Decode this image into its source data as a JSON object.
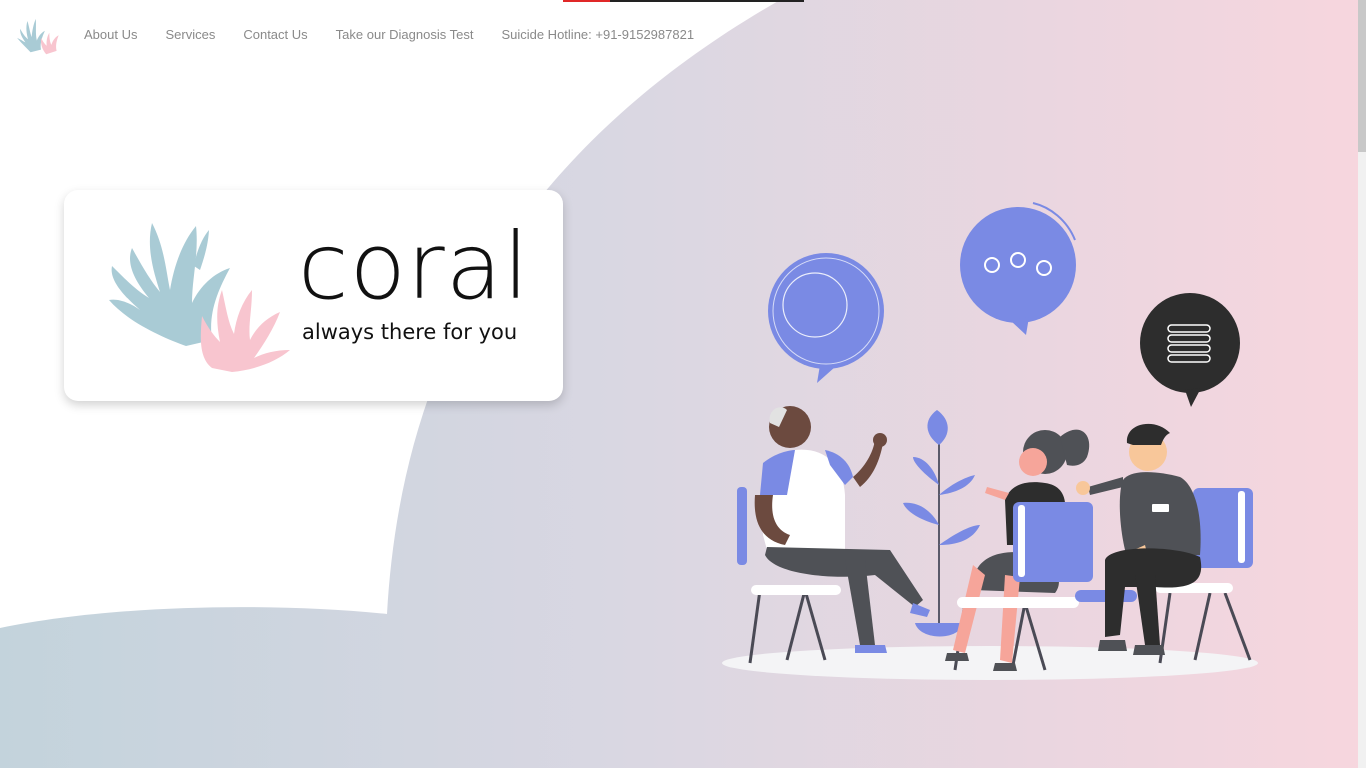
{
  "nav": {
    "links": [
      {
        "label": "About Us"
      },
      {
        "label": "Services"
      },
      {
        "label": "Contact Us"
      },
      {
        "label": "Take our Diagnosis Test"
      },
      {
        "label": "Suicide Hotline: +91-9152987821"
      }
    ]
  },
  "brand": {
    "name": "coral",
    "tagline": "always there for you"
  },
  "colors": {
    "gradient_left": "#c3d3dc",
    "gradient_mid": "#dcd7e2",
    "gradient_right": "#f6d6de",
    "coral_blue": "#a9cbd5",
    "coral_pink": "#f8c5cf",
    "accent_periwinkle": "#7a8ae4",
    "dark": "#2d2d2d"
  },
  "icons": {
    "nav_logo": "coral-logo-icon",
    "card_logo": "coral-logo-icon",
    "illustration": "group-therapy-illustration"
  }
}
